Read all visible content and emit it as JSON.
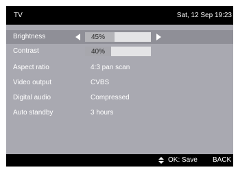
{
  "header": {
    "title": "TV",
    "datetime": "Sat, 12 Sep 19:23"
  },
  "menu": {
    "items": [
      {
        "label": "Brightness",
        "value": "45%",
        "level": 45,
        "selected": true
      },
      {
        "label": "Contrast",
        "value": "40%",
        "level": 40
      },
      {
        "label": "Aspect ratio",
        "value": "4:3 pan scan"
      },
      {
        "label": "Video output",
        "value": "CVBS"
      },
      {
        "label": "Digital audio",
        "value": "Compressed"
      },
      {
        "label": "Auto standby",
        "value": "3 hours"
      }
    ]
  },
  "footer": {
    "nav_icon": "up-down-arrows-icon",
    "ok_label": "OK: Save",
    "back_label": "BACK"
  },
  "colors": {
    "screen_bg": "#a9a9b1",
    "bar_bg": "#000000",
    "selected_row": "#8f8f97",
    "text": "#ffffff"
  }
}
